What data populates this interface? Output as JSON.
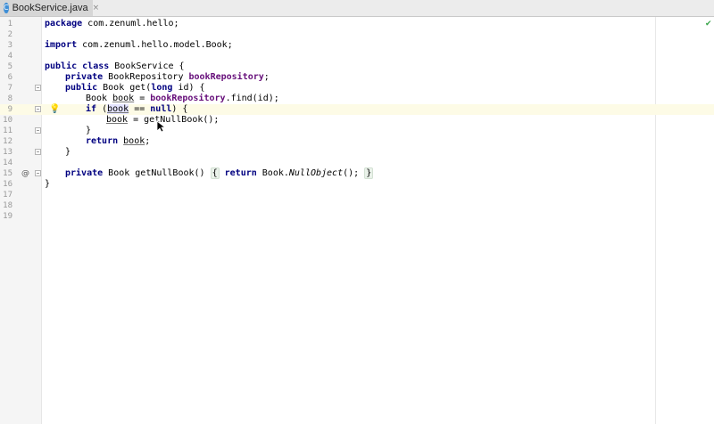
{
  "tab": {
    "icon": "java-class-icon",
    "icon_glyph": "C",
    "title": "BookService.java",
    "close_glyph": "×"
  },
  "line_numbers": [
    "1",
    "2",
    "3",
    "4",
    "5",
    "6",
    "7",
    "8",
    "9",
    "10",
    "11",
    "12",
    "13",
    "14",
    "15",
    "16",
    "17",
    "18",
    "19"
  ],
  "code": {
    "l1_kw": "package",
    "l1_rest": " com.zenuml.hello;",
    "l3_kw": "import",
    "l3_rest": " com.zenuml.hello.model.Book;",
    "l5_kw1": "public",
    "l5_kw2": "class",
    "l5_rest": " BookService {",
    "l6_kw": "private",
    "l6_type": " BookRepository ",
    "l6_field": "bookRepository",
    "l6_end": ";",
    "l7_kw1": "public",
    "l7_mid": " Book get(",
    "l7_kw2": "long",
    "l7_end": " id) {",
    "l8_type": "Book ",
    "l8_var": "book",
    "l8_eq": " = ",
    "l8_field": "bookRepository",
    "l8_end": ".find(id);",
    "l9_kw": "if",
    "l9_open": " (",
    "l9_var": "book",
    "l9_op": " == ",
    "l9_null": "null",
    "l9_end": ") {",
    "l10_var": "book",
    "l10_end": " = getNullBook();",
    "l11": "}",
    "l12_kw": "return",
    "l12_sp": " ",
    "l12_var": "book",
    "l12_end": ";",
    "l13": "}",
    "l15_kw": "private",
    "l15_mid": " Book getNullBook() ",
    "l15_brace1": "{",
    "l15_kw2": "return",
    "l15_call": " Book.",
    "l15_ital": "NullObject",
    "l15_end": "(); ",
    "l15_brace2": "}",
    "l16": "}"
  },
  "gutter": {
    "override_glyph": "@",
    "bulb_glyph": "💡"
  },
  "status": {
    "check_glyph": "✔",
    "check_color": "#3aa54a"
  },
  "colors": {
    "keyword": "#000080",
    "field": "#660e7a",
    "current_line": "#fdfbe6"
  }
}
